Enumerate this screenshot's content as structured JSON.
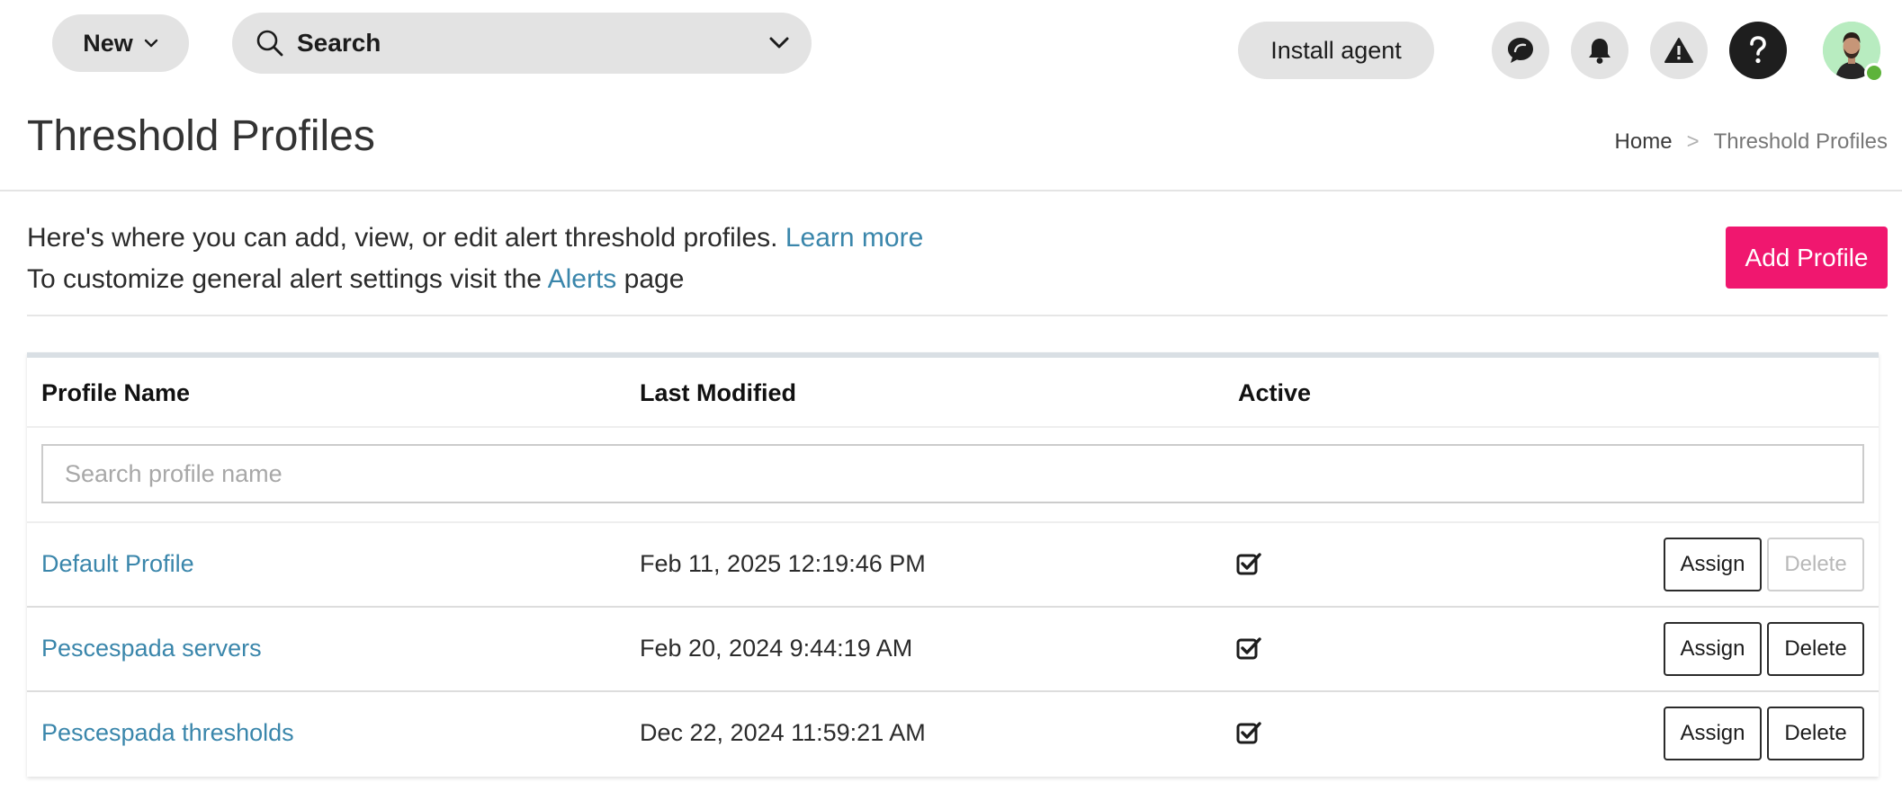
{
  "topbar": {
    "new_label": "New",
    "search_label": "Search",
    "install_label": "Install agent",
    "icons": [
      "chat-icon",
      "bell-icon",
      "warning-icon",
      "help-icon",
      "chevron-down-icon",
      "search-icon"
    ]
  },
  "page": {
    "title": "Threshold Profiles",
    "breadcrumb": {
      "home": "Home",
      "separator": ">",
      "current": "Threshold Profiles"
    }
  },
  "intro": {
    "line1_text": "Here's where you can add, view, or edit alert threshold profiles.",
    "line1_link": "Learn more",
    "line2_before": "To customize general alert settings visit the",
    "line2_link": "Alerts",
    "line2_after": "page"
  },
  "add_profile_label": "Add Profile",
  "table": {
    "columns": [
      "Profile Name",
      "Last Modified",
      "Active"
    ],
    "search_placeholder": "Search profile name",
    "rows": [
      {
        "name": "Default Profile",
        "modified": "Feb 11, 2025 12:19:46 PM",
        "active": true,
        "assign": "Assign",
        "delete": "Delete",
        "delete_enabled": false
      },
      {
        "name": "Pescespada servers",
        "modified": "Feb 20, 2024 9:44:19 AM",
        "active": true,
        "assign": "Assign",
        "delete": "Delete",
        "delete_enabled": true
      },
      {
        "name": "Pescespada thresholds",
        "modified": "Dec 22, 2024 11:59:21 AM",
        "active": true,
        "assign": "Assign",
        "delete": "Delete",
        "delete_enabled": true
      }
    ]
  },
  "colors": {
    "accent": "#f0176f",
    "link": "#3a86ab",
    "pill_bg": "#e3e3e3",
    "status_online": "#5db33a"
  }
}
